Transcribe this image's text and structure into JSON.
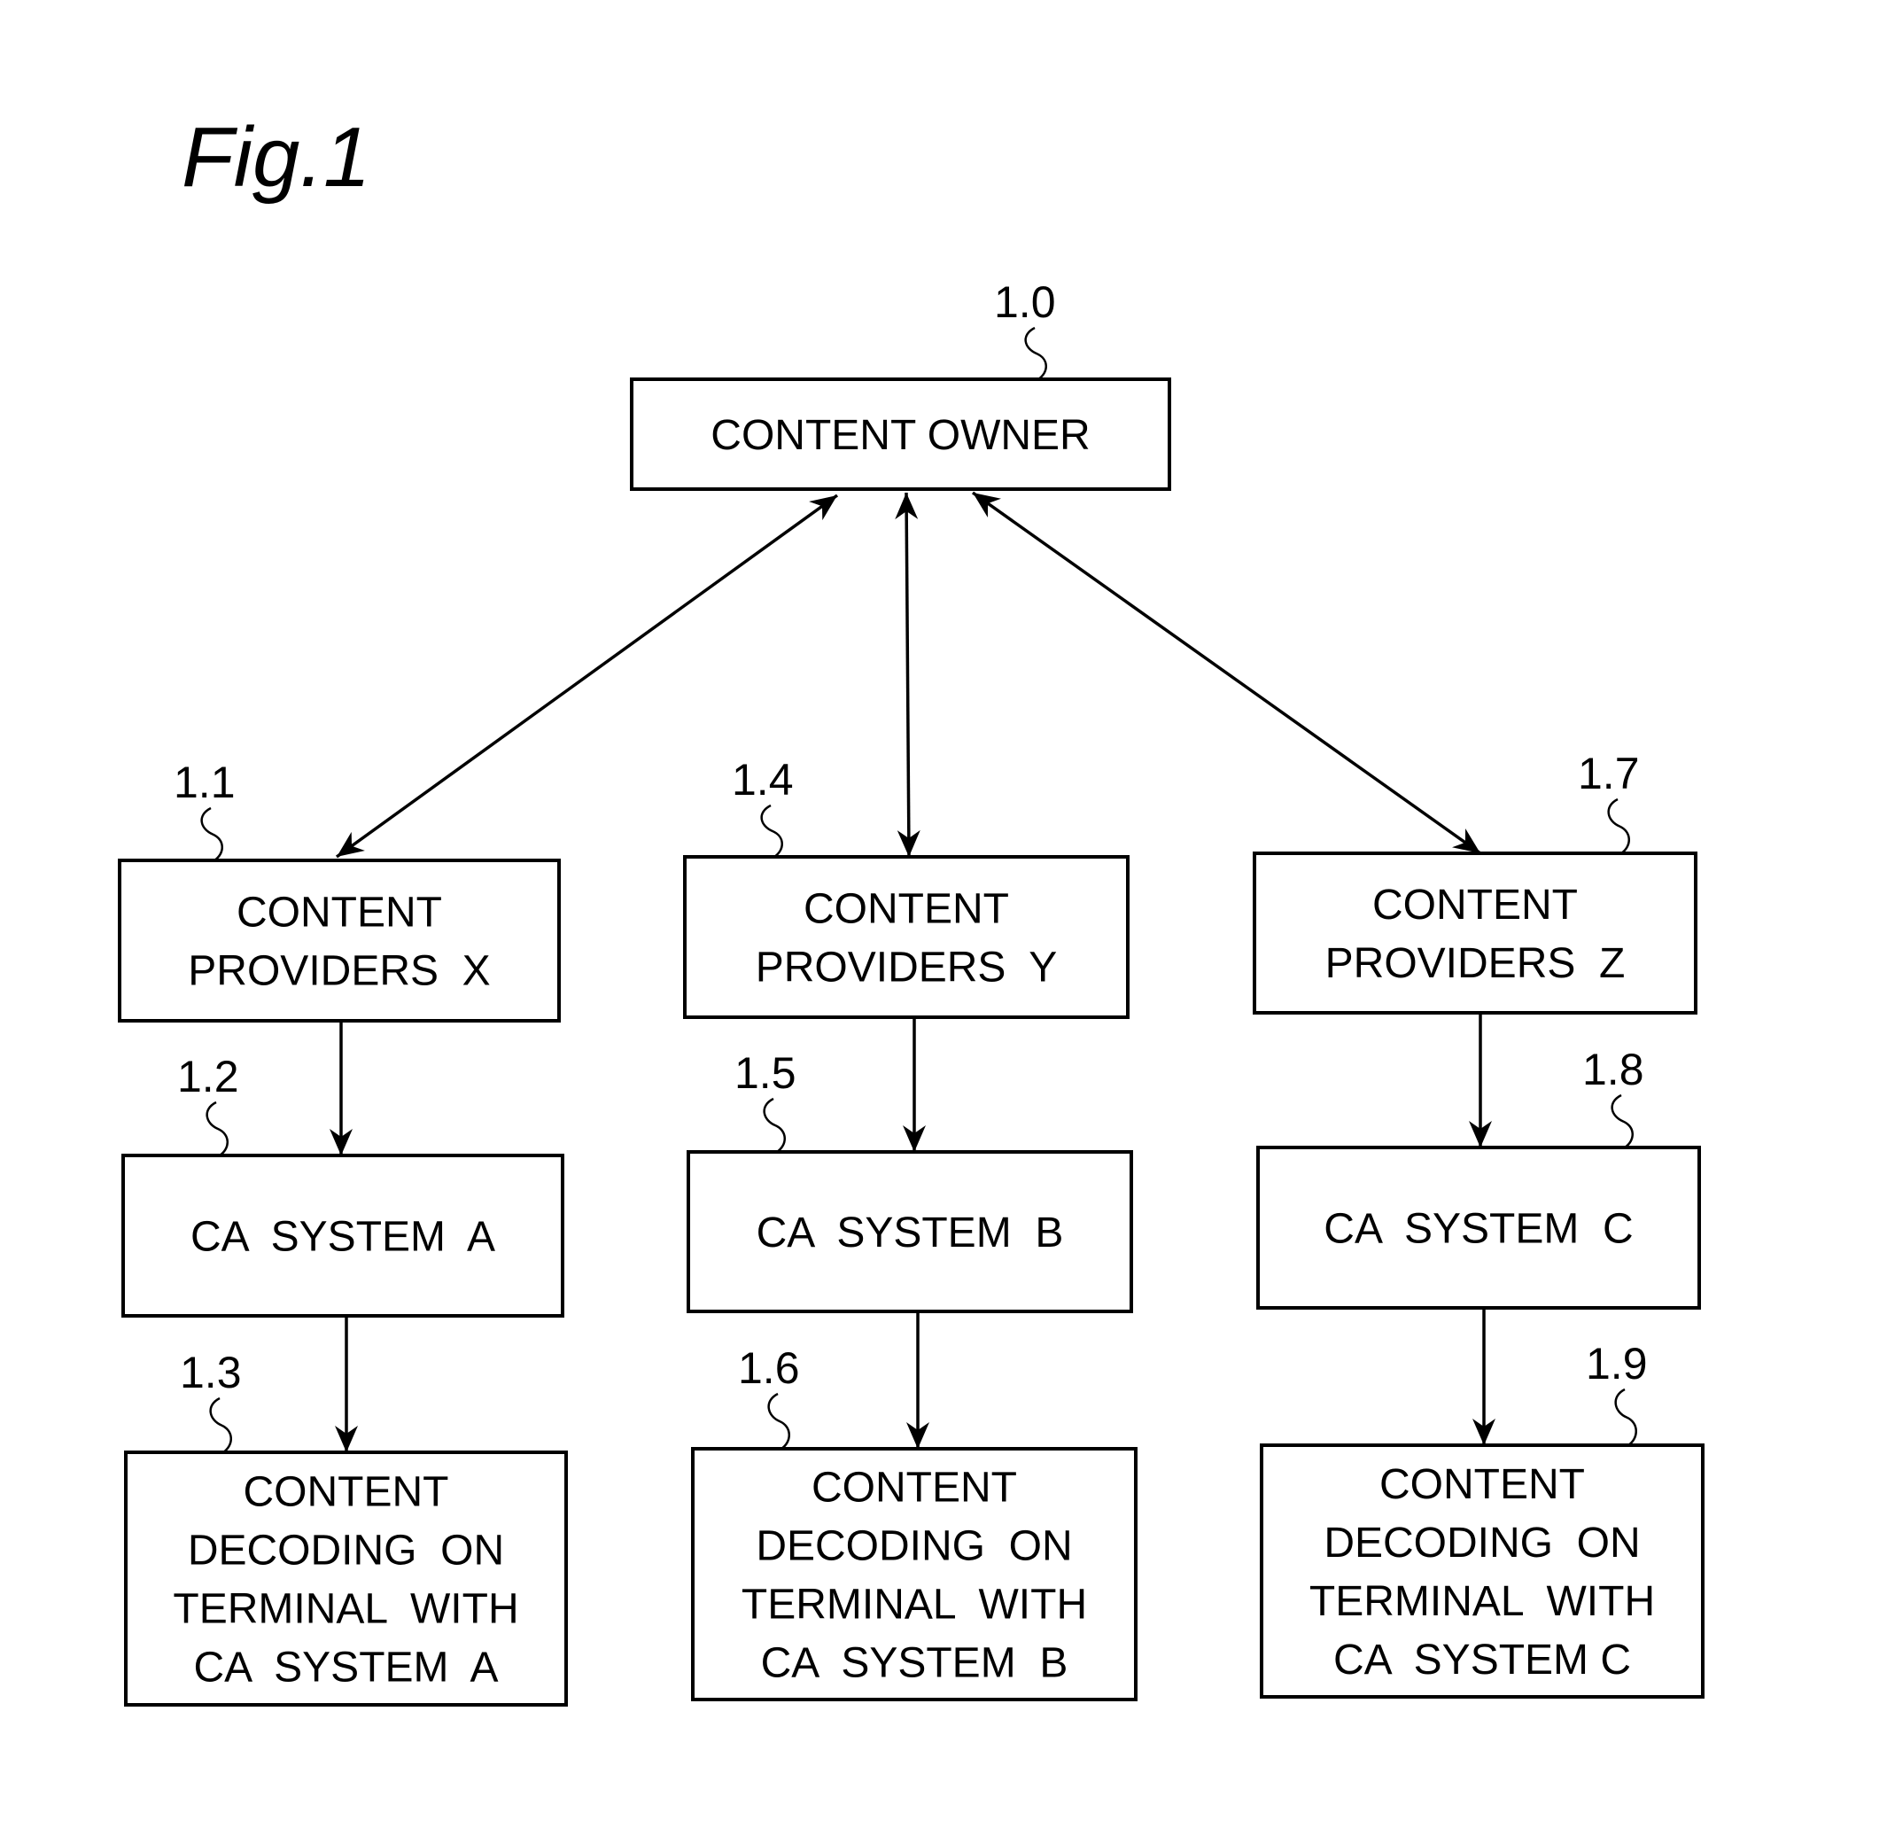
{
  "figure": {
    "title": "Fig.1"
  },
  "nodes": {
    "owner": {
      "ref": "1.0",
      "lines": [
        "CONTENT OWNER"
      ]
    },
    "prov_x": {
      "ref": "1.1",
      "lines": [
        "CONTENT",
        "PROVIDERS  X"
      ]
    },
    "ca_a": {
      "ref": "1.2",
      "lines": [
        "CA  SYSTEM  A"
      ]
    },
    "dec_a": {
      "ref": "1.3",
      "lines": [
        "CONTENT",
        "DECODING  ON",
        "TERMINAL  WITH",
        "CA  SYSTEM  A"
      ]
    },
    "prov_y": {
      "ref": "1.4",
      "lines": [
        "CONTENT",
        "PROVIDERS  Y"
      ]
    },
    "ca_b": {
      "ref": "1.5",
      "lines": [
        "CA  SYSTEM  B"
      ]
    },
    "dec_b": {
      "ref": "1.6",
      "lines": [
        "CONTENT",
        "DECODING  ON",
        "TERMINAL  WITH",
        "CA  SYSTEM  B"
      ]
    },
    "prov_z": {
      "ref": "1.7",
      "lines": [
        "CONTENT",
        "PROVIDERS  Z"
      ]
    },
    "ca_c": {
      "ref": "1.8",
      "lines": [
        "CA  SYSTEM  C"
      ]
    },
    "dec_c": {
      "ref": "1.9",
      "lines": [
        "CONTENT",
        "DECODING  ON",
        "TERMINAL  WITH",
        "CA  SYSTEM C"
      ]
    }
  },
  "edges": [
    {
      "from": "owner",
      "to": "prov_x",
      "direction": "bidirectional"
    },
    {
      "from": "owner",
      "to": "prov_y",
      "direction": "bidirectional"
    },
    {
      "from": "owner",
      "to": "prov_z",
      "direction": "bidirectional"
    },
    {
      "from": "prov_x",
      "to": "ca_a",
      "direction": "forward"
    },
    {
      "from": "ca_a",
      "to": "dec_a",
      "direction": "forward"
    },
    {
      "from": "prov_y",
      "to": "ca_b",
      "direction": "forward"
    },
    {
      "from": "ca_b",
      "to": "dec_b",
      "direction": "forward"
    },
    {
      "from": "prov_z",
      "to": "ca_c",
      "direction": "forward"
    },
    {
      "from": "ca_c",
      "to": "dec_c",
      "direction": "forward"
    }
  ]
}
